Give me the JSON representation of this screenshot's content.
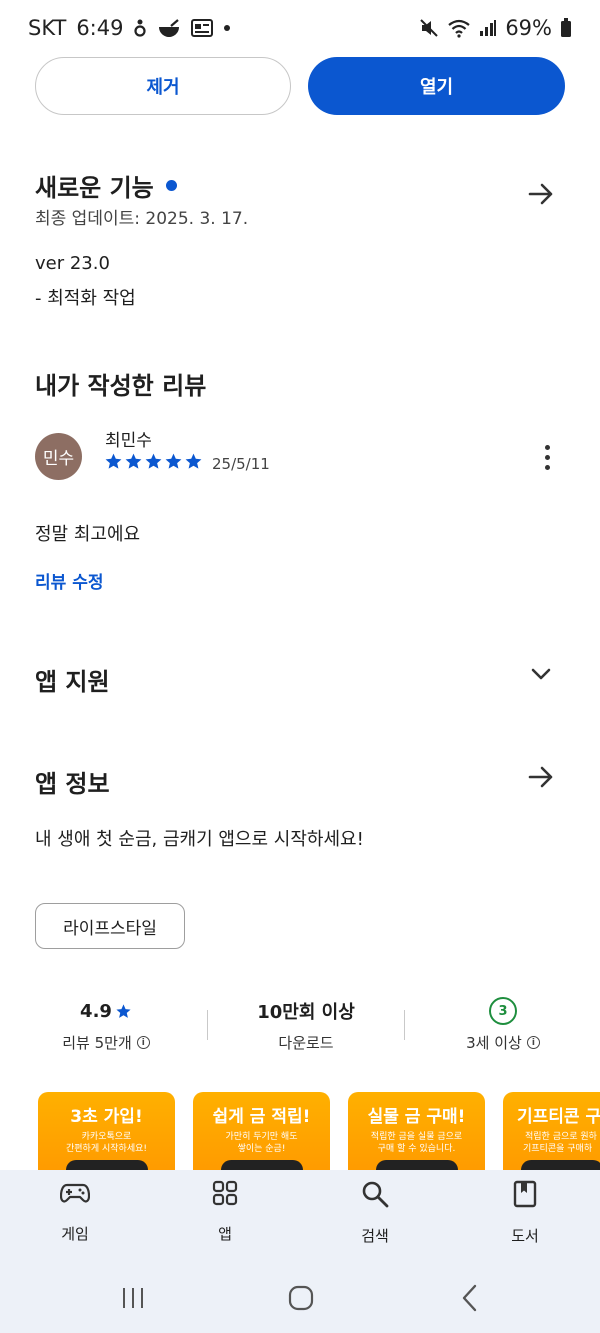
{
  "status_bar": {
    "carrier": "SKT",
    "time": "6:49",
    "battery": "69%"
  },
  "actions": {
    "remove_label": "제거",
    "open_label": "열기"
  },
  "whats_new": {
    "title": "새로운 기능",
    "updated": "최종 업데이트: 2025. 3. 17.",
    "version": "ver 23.0",
    "notes": "- 최적화 작업"
  },
  "my_review": {
    "title": "내가 작성한 리뷰",
    "avatar_text": "민수",
    "reviewer": "최민수",
    "rating": 5,
    "date": "25/5/11",
    "text": "정말 최고에요",
    "edit_label": "리뷰 수정"
  },
  "app_support": {
    "title": "앱 지원"
  },
  "app_info": {
    "title": "앱 정보",
    "description": "내 생애 첫 순금, 금캐기 앱으로 시작하세요!",
    "category_chip": "라이프스타일"
  },
  "stats": {
    "rating_value": "4.9",
    "rating_label": "리뷰 5만개",
    "downloads_value": "10만회 이상",
    "downloads_label": "다운로드",
    "age_value": "3",
    "age_label": "3세 이상"
  },
  "screenshots": [
    {
      "title": "3초 가입!",
      "desc1": "카카오톡으로",
      "desc2": "간편하게 시작하세요!"
    },
    {
      "title": "쉽게 금 적립!",
      "desc1": "가만히 두기만 해도",
      "desc2": "쌓이는 순금!"
    },
    {
      "title": "실물 금 구매!",
      "desc1": "적립한 금을 실물 금으로",
      "desc2": "구매 할 수 있습니다."
    },
    {
      "title": "기프티콘 구",
      "desc1": "적립한 금으로 원하",
      "desc2": "기프티콘을 구매하"
    }
  ],
  "bottom_nav": {
    "games": "게임",
    "apps": "앱",
    "search": "검색",
    "books": "도서"
  },
  "colors": {
    "accent": "#0b57d0",
    "star": "#0b57d0",
    "avatar": "#8d6e63",
    "age_badge": "#1e8e3e",
    "screenshot_bg": "#ff9f00",
    "nav_bg": "#edf1f8"
  },
  "icons": {
    "whats_new_arrow": "arrow-right-icon",
    "support_expand": "chevron-down-icon",
    "info_arrow": "arrow-right-icon",
    "more": "more-vert-icon",
    "games": "gamepad-icon",
    "apps": "apps-grid-icon",
    "search": "search-icon",
    "books": "book-icon"
  }
}
